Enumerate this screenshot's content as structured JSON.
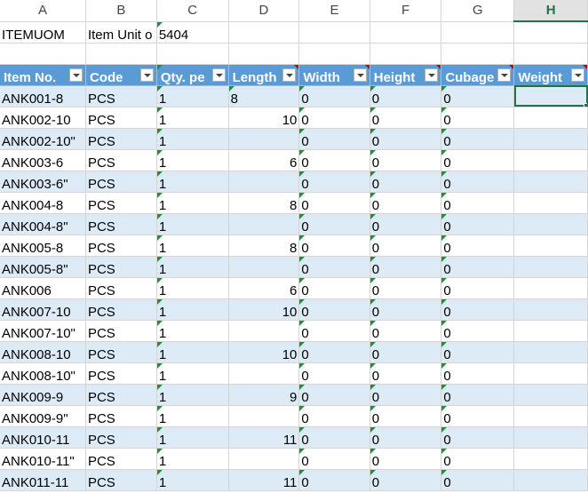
{
  "columns": [
    "A",
    "B",
    "C",
    "D",
    "E",
    "F",
    "G",
    "H"
  ],
  "row1": {
    "a": "ITEMUOM",
    "b": "Item Unit o",
    "c": "5404"
  },
  "headers": [
    "Item No.",
    "Code",
    "Qty. pe",
    "Length",
    "Width",
    "Height",
    "Cubage",
    "Weight"
  ],
  "rows": [
    [
      "ANK001-8",
      "PCS",
      "1",
      "8",
      "0",
      "0",
      "0"
    ],
    [
      "ANK002-10",
      "PCS",
      "1",
      "10",
      "0",
      "0",
      "0"
    ],
    [
      "ANK002-10\"",
      "PCS",
      "1",
      "",
      "0",
      "0",
      "0"
    ],
    [
      "ANK003-6",
      "PCS",
      "1",
      "6",
      "0",
      "0",
      "0"
    ],
    [
      "ANK003-6\"",
      "PCS",
      "1",
      "",
      "0",
      "0",
      "0"
    ],
    [
      "ANK004-8",
      "PCS",
      "1",
      "8",
      "0",
      "0",
      "0"
    ],
    [
      "ANK004-8\"",
      "PCS",
      "1",
      "",
      "0",
      "0",
      "0"
    ],
    [
      "ANK005-8",
      "PCS",
      "1",
      "8",
      "0",
      "0",
      "0"
    ],
    [
      "ANK005-8\"",
      "PCS",
      "1",
      "",
      "0",
      "0",
      "0"
    ],
    [
      "ANK006",
      "PCS",
      "1",
      "6",
      "0",
      "0",
      "0"
    ],
    [
      "ANK007-10",
      "PCS",
      "1",
      "10",
      "0",
      "0",
      "0"
    ],
    [
      "ANK007-10\"",
      "PCS",
      "1",
      "",
      "0",
      "0",
      "0"
    ],
    [
      "ANK008-10",
      "PCS",
      "1",
      "10",
      "0",
      "0",
      "0"
    ],
    [
      "ANK008-10\"",
      "PCS",
      "1",
      "",
      "0",
      "0",
      "0"
    ],
    [
      "ANK009-9",
      "PCS",
      "1",
      "9",
      "0",
      "0",
      "0"
    ],
    [
      "ANK009-9\"",
      "PCS",
      "1",
      "",
      "0",
      "0",
      "0"
    ],
    [
      "ANK010-11",
      "PCS",
      "1",
      "11",
      "0",
      "0",
      "0"
    ],
    [
      "ANK010-11\"",
      "PCS",
      "1",
      "",
      "0",
      "0",
      "0"
    ],
    [
      "ANK011-11",
      "PCS",
      "1",
      "11",
      "0",
      "0",
      "0"
    ]
  ],
  "colors": {
    "header_fill": "#5b9bd5",
    "band_fill": "#ddebf7",
    "selection": "#217346"
  }
}
